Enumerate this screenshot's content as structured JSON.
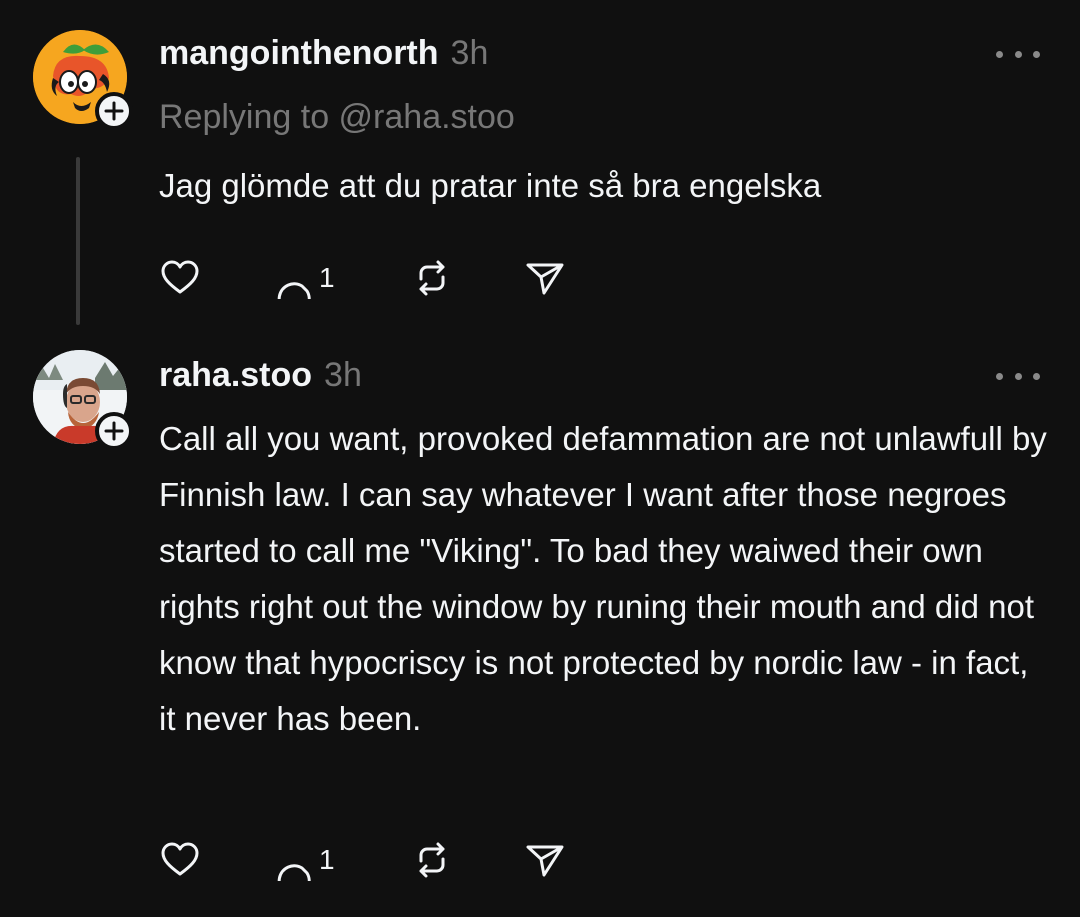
{
  "posts": [
    {
      "username": "mangointhenorth",
      "time": "3h",
      "reply_to": "Replying to @raha.stoo",
      "text": "Jag glömde att du pratar inte så bra engelska",
      "reply_count": "1",
      "avatar_icon": "mango-avatar-icon"
    },
    {
      "username": "raha.stoo",
      "time": "3h",
      "text": "Call all you want, provoked defammation are not unlawfull by Finnish law. I can say whatever I want after those negroes started to call me \"Viking\". To bad they waiwed their own rights right out the window by runing their mouth and did not know that hypocriscy is not protected by nordic law - in fact, it never has been.",
      "reply_count": "1",
      "avatar_icon": "profile-photo-avatar"
    }
  ],
  "colors": {
    "background": "#101010",
    "text": "#f3f5f7",
    "muted": "#777777",
    "thread_line": "#3a3a3a"
  }
}
